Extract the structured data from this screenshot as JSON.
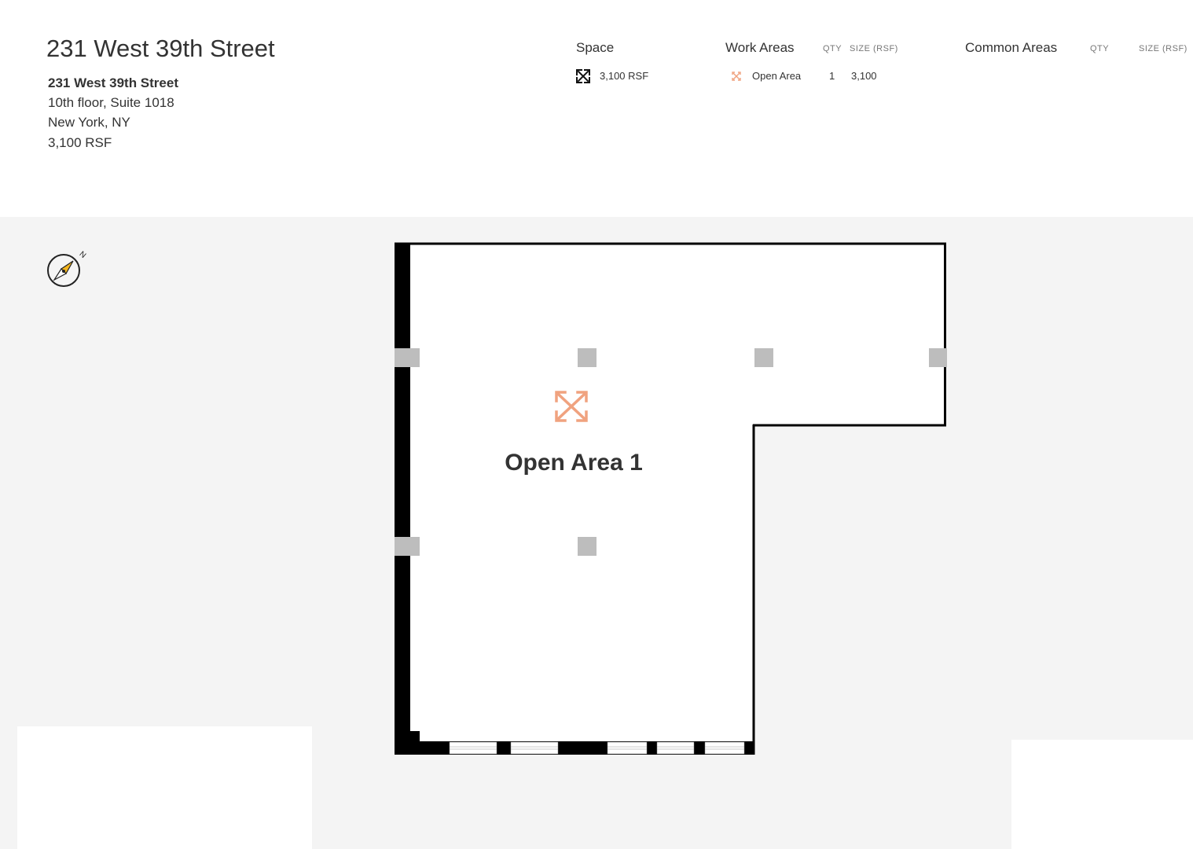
{
  "title": "231 West 39th Street",
  "address": {
    "line1": "231 West 39th Street",
    "line2": "10th floor, Suite 1018",
    "line3": "New York, NY",
    "line4": "3,100 RSF"
  },
  "space": {
    "heading": "Space",
    "value": "3,100 RSF",
    "icon": "expand-arrows-icon"
  },
  "work_areas": {
    "heading": "Work Areas",
    "qty_label": "QTY",
    "size_label": "SIZE (RSF)",
    "rows": [
      {
        "name": "Open Area",
        "qty": "1",
        "size": "3,100",
        "icon": "expand-arrows-icon",
        "color": "#f0a27f"
      }
    ]
  },
  "common_areas": {
    "heading": "Common Areas",
    "qty_label": "QTY",
    "size_label": "SIZE (RSF)"
  },
  "floorplan": {
    "compass_label": "N",
    "area_label": "Open Area 1",
    "colors": {
      "background": "#f4f4f4",
      "wall": "#000000",
      "column": "#bdbdbd",
      "area_icon": "#f0a27f",
      "compass_needle": "#f3b51c"
    }
  }
}
